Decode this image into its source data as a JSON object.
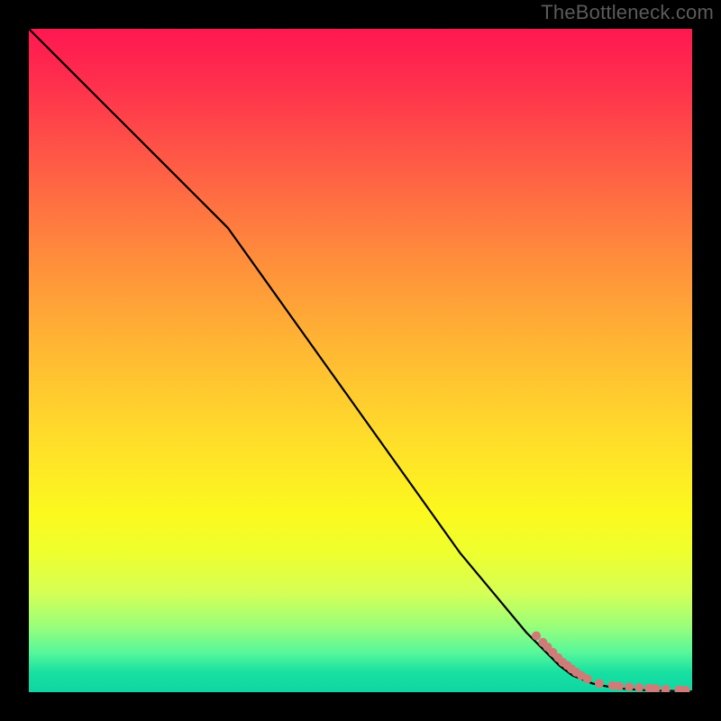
{
  "attribution": "TheBottleneck.com",
  "colors": {
    "page_bg": "#000000",
    "attribution": "#5b5b5b",
    "line": "#000000",
    "marker": "#cf7c78",
    "gradient_top": "#ff1751",
    "gradient_bottom": "#0fd6a2"
  },
  "chart_data": {
    "type": "line",
    "title": "",
    "xlabel": "",
    "ylabel": "",
    "xlim": [
      0,
      100
    ],
    "ylim": [
      0,
      100
    ],
    "grid": false,
    "legend": false,
    "series": [
      {
        "name": "curve",
        "style": "line",
        "color": "#000000",
        "x": [
          0.0,
          5.0,
          10.0,
          15.0,
          20.0,
          25.0,
          28.0,
          30.0,
          35.0,
          40.0,
          45.0,
          50.0,
          55.0,
          60.0,
          65.0,
          70.0,
          75.0,
          80.0,
          82.0,
          85.0,
          88.0,
          90.0,
          93.0,
          96.0,
          100.0
        ],
        "y": [
          100.0,
          95.0,
          90.0,
          85.0,
          80.0,
          75.0,
          72.0,
          70.0,
          63.0,
          56.0,
          49.0,
          42.0,
          35.0,
          28.0,
          21.0,
          15.0,
          9.0,
          4.0,
          2.5,
          1.3,
          0.7,
          0.5,
          0.3,
          0.2,
          0.1
        ]
      },
      {
        "name": "markers",
        "style": "scatter",
        "color": "#cf7c78",
        "x": [
          76.5,
          77.5,
          78.2,
          79.0,
          79.8,
          80.5,
          81.2,
          81.8,
          82.5,
          83.3,
          84.2,
          86.0,
          88.0,
          89.0,
          90.5,
          92.0,
          93.5,
          94.5,
          96.0,
          98.0,
          99.0
        ],
        "y": [
          8.5,
          7.5,
          6.8,
          6.0,
          5.2,
          4.5,
          4.0,
          3.5,
          3.0,
          2.5,
          2.0,
          1.3,
          1.0,
          0.9,
          0.8,
          0.7,
          0.6,
          0.55,
          0.45,
          0.35,
          0.3
        ]
      }
    ]
  }
}
